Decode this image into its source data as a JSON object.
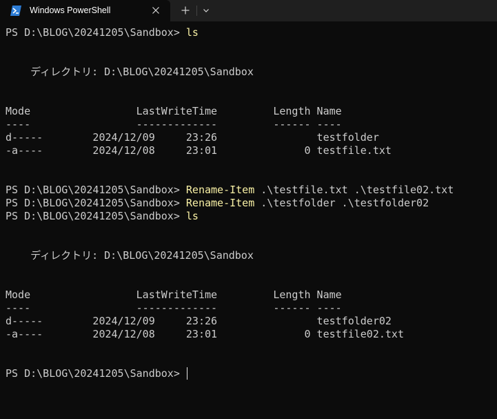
{
  "window": {
    "tab_title": "Windows PowerShell",
    "tab_icon": "powershell-icon",
    "close_icon": "close-icon",
    "new_tab_icon": "plus-icon",
    "dropdown_icon": "chevron-down-icon"
  },
  "colors": {
    "background": "#0c0c0c",
    "titlebar": "#1f1f1f",
    "text": "#cccccc",
    "command": "#f9f1a5"
  },
  "terminal": {
    "prompt": "PS D:\\BLOG\\20241205\\Sandbox> ",
    "ls1": {
      "command": "ls",
      "directory": "    ディレクトリ: D:\\BLOG\\20241205\\Sandbox",
      "header": "Mode                 LastWriteTime         Length Name",
      "underline": "----                 -------------         ------ ----",
      "rows": [
        "d-----        2024/12/09     23:26                testfolder",
        "-a----        2024/12/08     23:01              0 testfile.txt"
      ]
    },
    "rename1": {
      "command": "Rename-Item",
      "args": " .\\testfile.txt .\\testfile02.txt"
    },
    "rename2": {
      "command": "Rename-Item",
      "args": " .\\testfolder .\\testfolder02"
    },
    "ls2": {
      "command": "ls",
      "directory": "    ディレクトリ: D:\\BLOG\\20241205\\Sandbox",
      "header": "Mode                 LastWriteTime         Length Name",
      "underline": "----                 -------------         ------ ----",
      "rows": [
        "d-----        2024/12/09     23:26                testfolder02",
        "-a----        2024/12/08     23:01              0 testfile02.txt"
      ]
    }
  }
}
